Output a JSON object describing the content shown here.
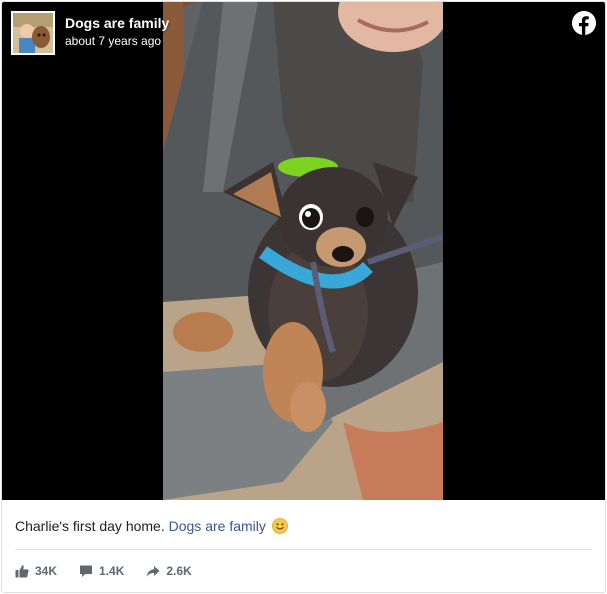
{
  "post": {
    "page_name": "Dogs are family",
    "timestamp": "about 7 years ago",
    "caption_text": "Charlie's first day home.",
    "caption_link": "Dogs are family",
    "caption_emoji": "slightly-smiling-face-emoji"
  },
  "stats": {
    "likes": "34K",
    "comments": "1.4K",
    "shares": "2.6K"
  },
  "icons": {
    "like": "thumbs-up-icon",
    "comment": "comment-bubble-icon",
    "share": "share-arrow-icon",
    "brand": "facebook-logo-icon"
  },
  "colors": {
    "link": "#385898",
    "meta": "#606770",
    "text": "#1c1e21",
    "media_background": "#000000"
  }
}
